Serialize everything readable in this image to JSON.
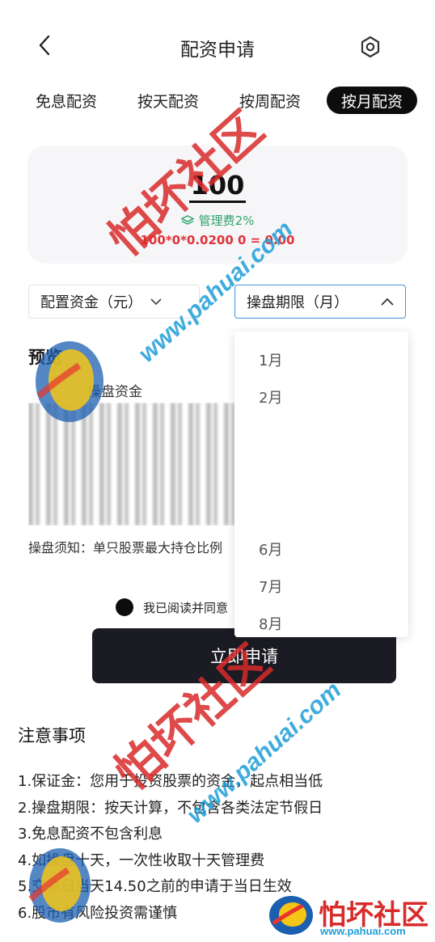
{
  "header": {
    "title": "配资申请",
    "back_icon": "chevron-left-icon",
    "settings_icon": "settings-icon"
  },
  "tabs": [
    {
      "label": "免息配资",
      "active": false
    },
    {
      "label": "按天配资",
      "active": false
    },
    {
      "label": "按周配资",
      "active": false
    },
    {
      "label": "按月配资",
      "active": true
    }
  ],
  "summary": {
    "amount": "100",
    "fee_label": "管理费2%",
    "formula": "100*0*0.0200 0 = 0.00",
    "fee_color": "#2fa36b",
    "formula_color": "#e0323a"
  },
  "selects": {
    "amount_select": "配置资金（元）",
    "period_select": "操盘期限（月）"
  },
  "preview": {
    "title": "预览",
    "subtitle": "操盘资金",
    "notice": "操盘须知：单只股票最大持仓比例"
  },
  "dropdown": {
    "options": [
      "1月",
      "2月",
      "6月",
      "7月",
      "8月"
    ]
  },
  "agree_text": "我已阅读并同意",
  "submit_label": "立即申请",
  "notes": {
    "title": "注意事项",
    "items": [
      "1.保证金：您用于投资股票的资金，起点相当低",
      "2.操盘期限：按天计算，不包含各类法定节假日",
      "3.免息配资不包含利息",
      "4.如操盘十天，一次性收取十天管理费",
      "5.交易日当天14.50之前的申请于当日生效",
      "6.股市有风险投资需谨慎"
    ]
  },
  "watermark": {
    "text": "怕坏社区",
    "url": "www.pahuai.com",
    "text_color": "#d92b2b",
    "url_color": "#1e9ed8"
  },
  "colors": {
    "accent": "#0d0d0d",
    "button_bg": "#1b1b23",
    "select_border_active": "#4a90e2"
  }
}
